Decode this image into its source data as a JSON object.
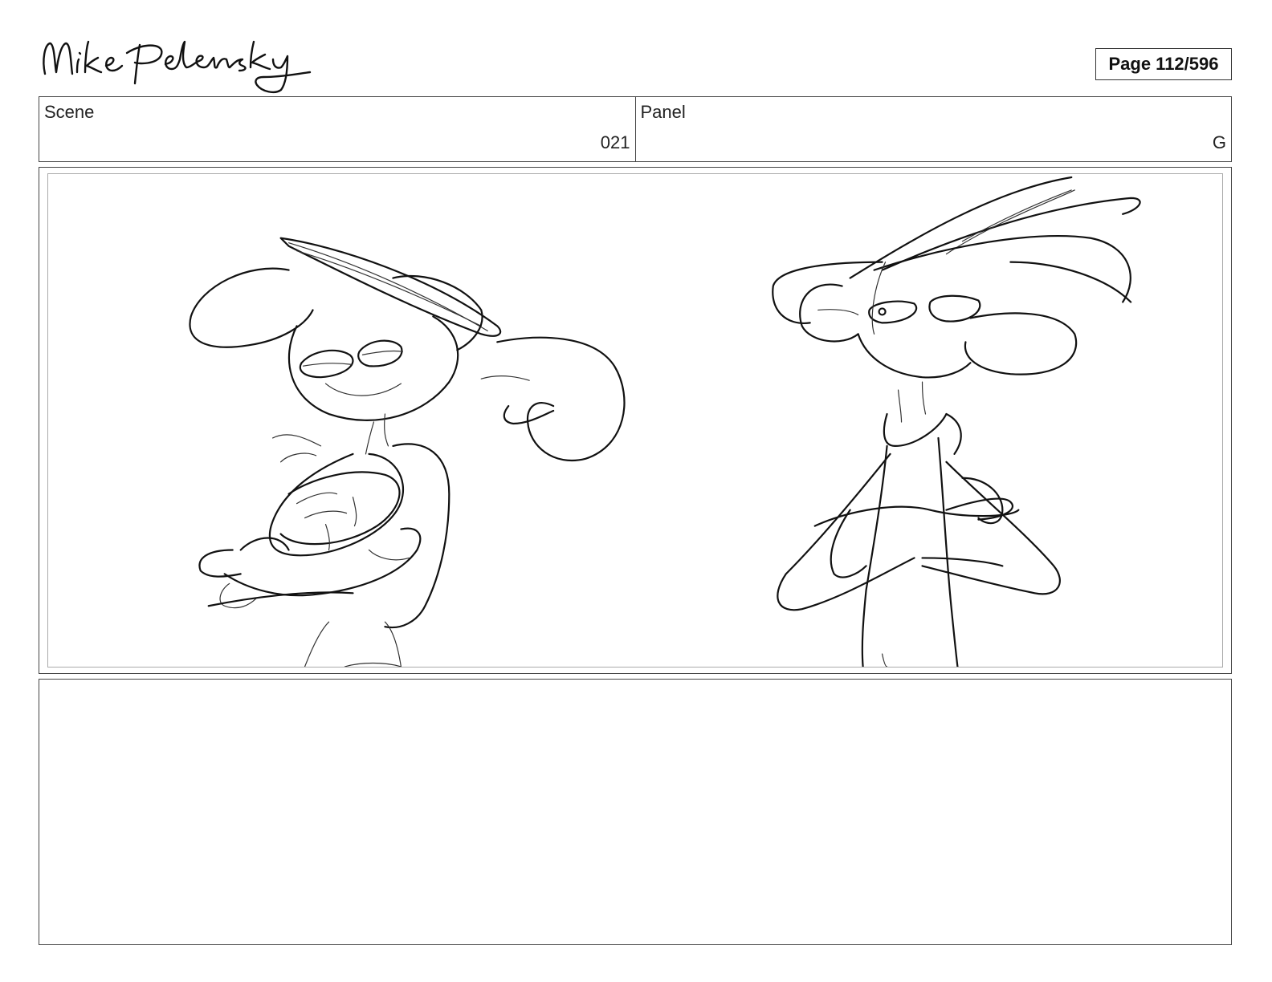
{
  "header": {
    "signature_text": "Mike Pelensky",
    "page_label": "Page 112/596"
  },
  "info": {
    "scene_label": "Scene",
    "scene_value": "021",
    "panel_label": "Panel",
    "panel_value": "G"
  },
  "notes": {
    "text": ""
  }
}
